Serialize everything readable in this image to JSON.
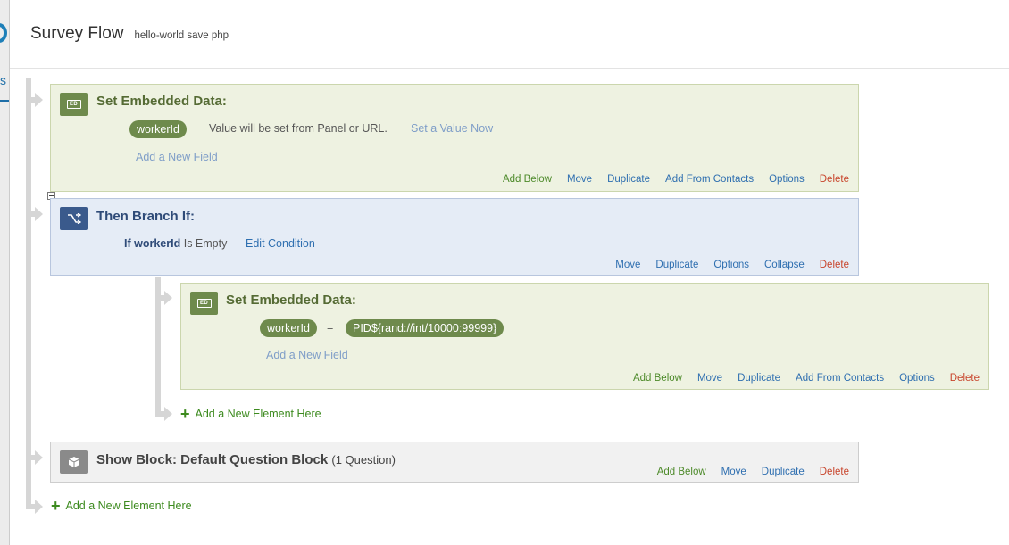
{
  "modal": {
    "title": "Survey Flow",
    "subtitle": "hello-world save php"
  },
  "background": {
    "tab_letter": "s"
  },
  "flow": {
    "set_embedded_1": {
      "title": "Set Embedded Data:",
      "icon": "ED",
      "field": "workerId",
      "value_text": "Value will be set from Panel or URL.",
      "set_value_link": "Set a Value Now",
      "add_field_link": "Add a New Field",
      "actions": [
        "Add Below",
        "Move",
        "Duplicate",
        "Add From Contacts",
        "Options",
        "Delete"
      ]
    },
    "branch": {
      "title": "Then Branch If:",
      "condition_if": "If",
      "condition_field": "workerId",
      "condition_operator": "Is Empty",
      "edit_condition_link": "Edit Condition",
      "actions": [
        "Move",
        "Duplicate",
        "Options",
        "Collapse",
        "Delete"
      ]
    },
    "set_embedded_2": {
      "title": "Set Embedded Data:",
      "icon": "ED",
      "field": "workerId",
      "equals": "=",
      "value": "PID${rand://int/10000:99999}",
      "add_field_link": "Add a New Field",
      "actions": [
        "Add Below",
        "Move",
        "Duplicate",
        "Add From Contacts",
        "Options",
        "Delete"
      ]
    },
    "add_element_inner": "Add a New Element Here",
    "show_block": {
      "title": "Show Block: Default Question Block",
      "question_count": "(1 Question)",
      "actions": [
        "Add Below",
        "Move",
        "Duplicate",
        "Delete"
      ]
    },
    "add_element_outer": "Add a New Element Here"
  },
  "colors": {
    "green_accent": "#6e8a4c",
    "blue_accent": "#3a5a8c",
    "delete_red": "#c8442b",
    "link_blue": "#2f6fb0"
  }
}
